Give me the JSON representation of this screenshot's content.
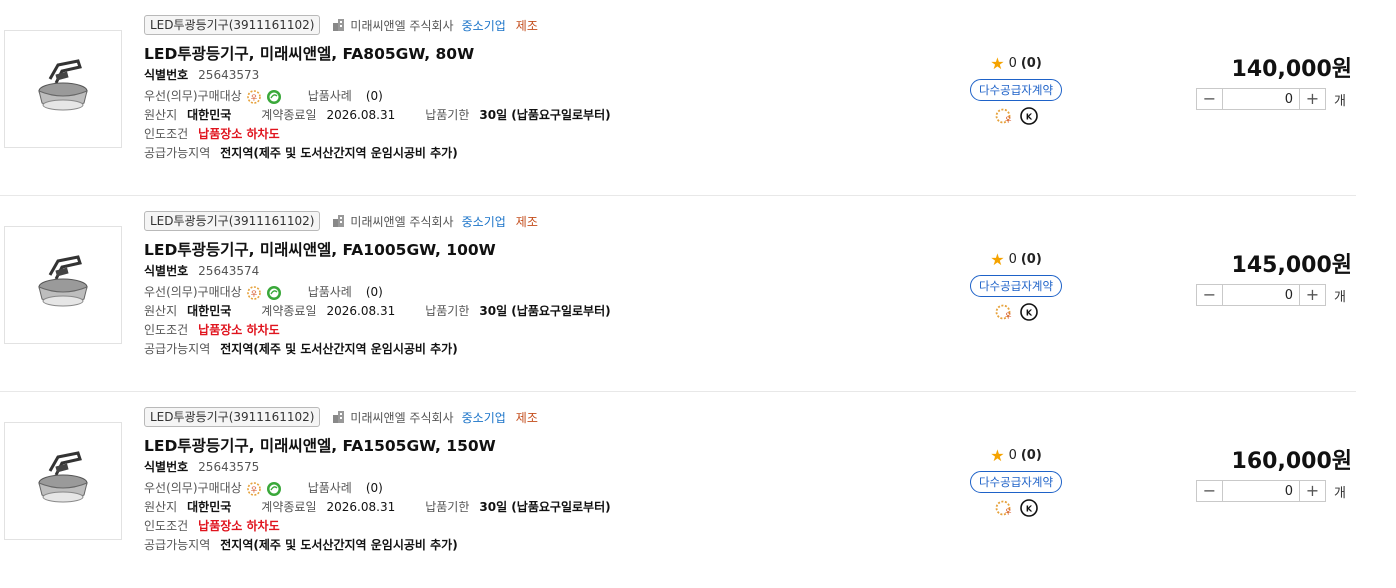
{
  "labels": {
    "id_label": "식별번호",
    "priority": "우선(의무)구매대상",
    "cases": "납품사례",
    "origin": "원산지",
    "contract_end": "계약종료일",
    "deadline": "납품기한",
    "delivery_cond": "인도조건",
    "supply_area": "공급가능지역",
    "multi_supplier": "다수공급자계약",
    "unit": "개",
    "sme": "중소기업",
    "manufacture": "제조"
  },
  "colors": {
    "accent_blue": "#1e62c8",
    "red": "#e0141e",
    "star": "#f5a300"
  },
  "items": [
    {
      "category": "LED투광등기구(3911161102)",
      "company": "미래씨앤엘 주식회사",
      "name": "LED투광등기구, 미래씨앤엘, FA805GW, 80W",
      "id": "25643573",
      "cases": "(0)",
      "origin": "대한민국",
      "contract_end": "2026.08.31",
      "deadline": "30일 (납품요구일로부터)",
      "delivery_cond": "납품장소 하차도",
      "supply_area": "전지역(제주 및 도서산간지역 운임시공비 추가)",
      "rating": "0",
      "rating_count": "(0)",
      "price": "140,000원",
      "qty": "0"
    },
    {
      "category": "LED투광등기구(3911161102)",
      "company": "미래씨앤엘 주식회사",
      "name": "LED투광등기구, 미래씨앤엘, FA1005GW, 100W",
      "id": "25643574",
      "cases": "(0)",
      "origin": "대한민국",
      "contract_end": "2026.08.31",
      "deadline": "30일 (납품요구일로부터)",
      "delivery_cond": "납품장소 하차도",
      "supply_area": "전지역(제주 및 도서산간지역 운임시공비 추가)",
      "rating": "0",
      "rating_count": "(0)",
      "price": "145,000원",
      "qty": "0"
    },
    {
      "category": "LED투광등기구(3911161102)",
      "company": "미래씨앤엘 주식회사",
      "name": "LED투광등기구, 미래씨앤엘, FA1505GW, 150W",
      "id": "25643575",
      "cases": "(0)",
      "origin": "대한민국",
      "contract_end": "2026.08.31",
      "deadline": "30일 (납품요구일로부터)",
      "delivery_cond": "납품장소 하차도",
      "supply_area": "전지역(제주 및 도서산간지역 운임시공비 추가)",
      "rating": "0",
      "rating_count": "(0)",
      "price": "160,000원",
      "qty": "0"
    }
  ]
}
